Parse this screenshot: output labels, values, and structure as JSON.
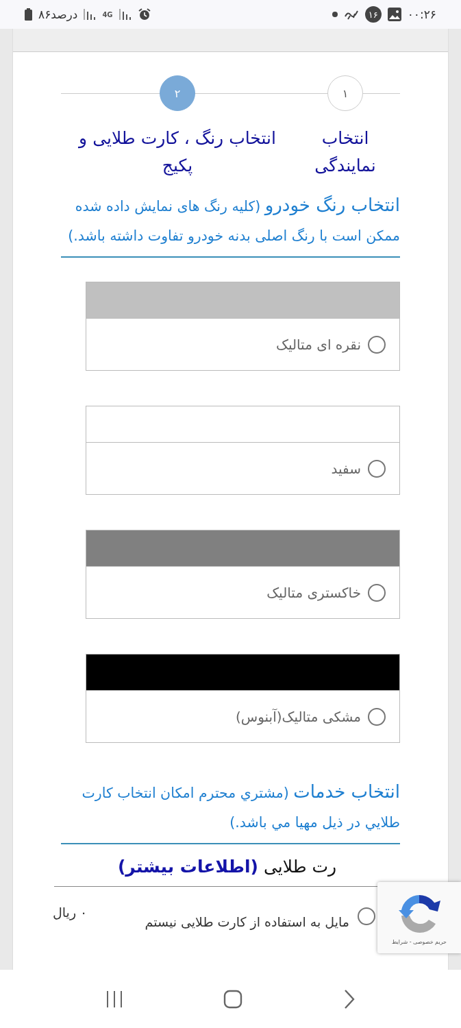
{
  "status_bar": {
    "time": "۰۰:۲۶",
    "notification_count": "۱۶",
    "network": "4G",
    "battery": "۸۶درصد"
  },
  "steps": [
    {
      "number": "۱",
      "label": "انتخاب نمایندگی",
      "selected": false
    },
    {
      "number": "۲",
      "label": "انتخاب رنگ ، کارت طلایی و پکیج",
      "selected": true
    }
  ],
  "color_section": {
    "title": "انتخاب رنگ خودرو",
    "note": "(کلیه رنگ های نمایش داده شده ممکن است با رنگ اصلی بدنه خودرو تفاوت داشته باشد.)"
  },
  "colors": [
    {
      "name": "نقره ای متالیک",
      "color": "#c0c0c0",
      "selected": false
    },
    {
      "name": "سفید",
      "color": "#ffffff",
      "selected": false
    },
    {
      "name": "خاکستری متالیک",
      "color": "#808080",
      "selected": false
    },
    {
      "name": "مشکی متالیک(آبنوس)",
      "color": "#000000",
      "selected": false
    }
  ],
  "services_section": {
    "title": "انتخاب خدمات",
    "note": "(مشتري محترم امكان انتخاب كارت طلايي در ذيل مهيا مي باشد.)"
  },
  "golden_card": {
    "title": "رت طلایی",
    "link": "(اطلاعات بیشتر)",
    "options": [
      {
        "label": "مایل به استفاده از کارت طلایی نیستم",
        "price": "۰ ریال",
        "selected": false
      }
    ]
  },
  "recaptcha": {
    "links": "حریم خصوصی - شرایط"
  }
}
